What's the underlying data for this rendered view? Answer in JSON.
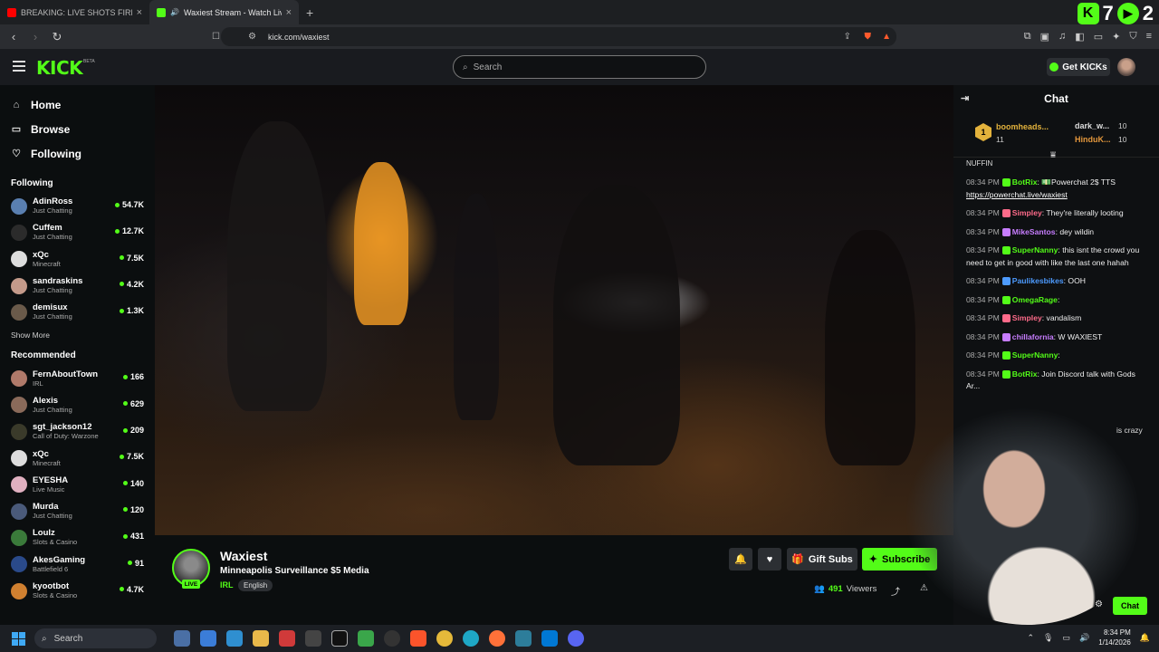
{
  "browser": {
    "tabs": [
      {
        "title": "BREAKING: LIVE SHOTS FIRED Amid",
        "favicon_color": "#ff0000"
      },
      {
        "title": "Waxiest Stream - Watch Live",
        "favicon_color": "#53fc18"
      }
    ],
    "url": "kick.com/waxiest",
    "promo_number_1": "7",
    "promo_number_2": "2"
  },
  "header": {
    "logo": "KICK",
    "beta": "BETA",
    "search_placeholder": "Search",
    "get_kicks": "Get KICKs"
  },
  "sidebar": {
    "nav": [
      {
        "label": "Home",
        "icon": "home-icon"
      },
      {
        "label": "Browse",
        "icon": "browse-icon"
      },
      {
        "label": "Following",
        "icon": "heart-icon"
      }
    ],
    "following_title": "Following",
    "following": [
      {
        "name": "AdinRoss",
        "category": "Just Chatting",
        "viewers": "54.7K",
        "color": "#5a7fb0"
      },
      {
        "name": "Cuffem",
        "category": "Just Chatting",
        "viewers": "12.7K",
        "color": "#2b2b2b"
      },
      {
        "name": "xQc",
        "category": "Minecraft",
        "viewers": "7.5K",
        "color": "#dddddd"
      },
      {
        "name": "sandraskins",
        "category": "Just Chatting",
        "viewers": "4.2K",
        "color": "#c49a8a"
      },
      {
        "name": "demisux",
        "category": "Just Chatting",
        "viewers": "1.3K",
        "color": "#6a5a4a"
      }
    ],
    "show_more": "Show More",
    "recommended_title": "Recommended",
    "recommended": [
      {
        "name": "FernAboutTown",
        "category": "IRL",
        "viewers": "166",
        "color": "#b07a6a"
      },
      {
        "name": "Alexis",
        "category": "Just Chatting",
        "viewers": "629",
        "color": "#8a6a5a"
      },
      {
        "name": "sgt_jackson12",
        "category": "Call of Duty: Warzone",
        "viewers": "209",
        "color": "#3a3a2a"
      },
      {
        "name": "xQc",
        "category": "Minecraft",
        "viewers": "7.5K",
        "color": "#dddddd"
      },
      {
        "name": "EYESHA",
        "category": "Live Music",
        "viewers": "140",
        "color": "#e0b0c0"
      },
      {
        "name": "Murda",
        "category": "Just Chatting",
        "viewers": "120",
        "color": "#4a5a7a"
      },
      {
        "name": "Loulz",
        "category": "Slots & Casino",
        "viewers": "431",
        "color": "#3a7a3a"
      },
      {
        "name": "AkesGaming",
        "category": "Battlefield 6",
        "viewers": "91",
        "color": "#2a4a8a"
      },
      {
        "name": "kyootbot",
        "category": "Slots & Casino",
        "viewers": "4.7K",
        "color": "#d08030"
      }
    ]
  },
  "stream": {
    "name": "Waxiest",
    "title": "Minneapolis Surveillance $5 Media",
    "category": "IRL",
    "tag": "English",
    "live": "LIVE",
    "gift_subs": "Gift Subs",
    "subscribe": "Subscribe",
    "viewers": "491",
    "viewers_label": "Viewers"
  },
  "chat": {
    "title": "Chat",
    "top_gifters": [
      {
        "name": "boomheads...",
        "count": "11"
      },
      {
        "name": "dark_w...",
        "count": "10"
      },
      {
        "name": "HinduK...",
        "count": "10"
      }
    ],
    "rank": "1",
    "cutoff_text": "NUFFIN",
    "messages": [
      {
        "time": "08:34 PM",
        "user": "BotRix",
        "color": "#53fc18",
        "text": ": 💵Powerchat 2$ TTS ",
        "link": "https://powerchat.live/waxiest"
      },
      {
        "time": "08:34 PM",
        "user": "Simpley",
        "color": "#ff6b8a",
        "text": ": They're literally looting",
        "link": ""
      },
      {
        "time": "08:34 PM",
        "user": "MikeSantos",
        "color": "#c77dff",
        "text": ": dey wildin",
        "link": ""
      },
      {
        "time": "08:34 PM",
        "user": "SuperNanny",
        "color": "#53fc18",
        "text": ": this isnt the crowd you need to get in good with like the last one hahah",
        "link": ""
      },
      {
        "time": "08:34 PM",
        "user": "Paulikesbikes",
        "color": "#4d9bff",
        "text": ": OOH",
        "link": ""
      },
      {
        "time": "08:34 PM",
        "user": "OmegaRage",
        "color": "#53fc18",
        "text": ":",
        "link": ""
      },
      {
        "time": "08:34 PM",
        "user": "Simpley",
        "color": "#ff6b8a",
        "text": ": vandalism",
        "link": ""
      },
      {
        "time": "08:34 PM",
        "user": "chillafornia",
        "color": "#c77dff",
        "text": ": W WAXIEST",
        "link": ""
      },
      {
        "time": "08:34 PM",
        "user": "SuperNanny",
        "color": "#53fc18",
        "text": ":",
        "link": ""
      },
      {
        "time": "08:34 PM",
        "user": "BotRix",
        "color": "#53fc18",
        "text": ": Join Discord talk with Gods Ar...",
        "link": ""
      }
    ],
    "trailing_text": "is crazy",
    "chat_button": "Chat"
  },
  "taskbar": {
    "search": "Search",
    "time": "8:34 PM",
    "date": "1/14/2026"
  }
}
